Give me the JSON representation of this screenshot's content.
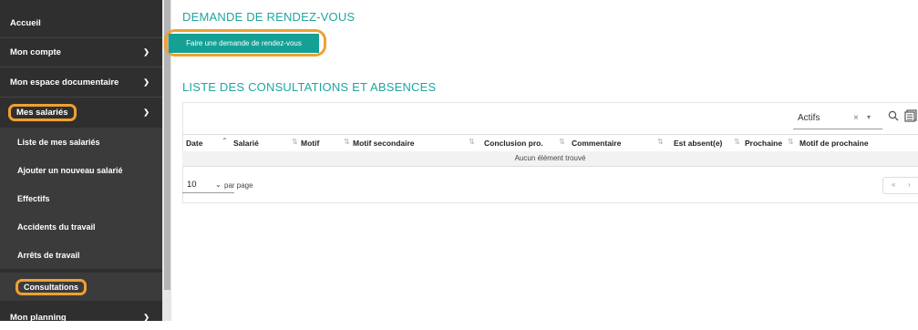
{
  "sidebar": {
    "items": [
      {
        "label": "Accueil"
      },
      {
        "label": "Mon compte"
      },
      {
        "label": "Mon espace documentaire"
      },
      {
        "label": "Mes salariés"
      },
      {
        "label": "Liste de mes salariés"
      },
      {
        "label": "Ajouter un nouveau salarié"
      },
      {
        "label": "Effectifs"
      },
      {
        "label": "Accidents du travail"
      },
      {
        "label": "Arrêts de travail"
      },
      {
        "label": "Consultations"
      },
      {
        "label": "Mon planning"
      }
    ]
  },
  "main": {
    "section1_title": "DEMANDE DE RENDEZ-VOUS",
    "request_button": "Faire une demande de rendez-vous",
    "section2_title": "LISTE DES CONSULTATIONS ET ABSENCES",
    "filter_value": "Actifs",
    "columns": [
      "Date",
      "Salarié",
      "Motif",
      "Motif secondaire",
      "Conclusion pro.",
      "Commentaire",
      "Est absent(e)",
      "Prochaine",
      "Motif de prochaine"
    ],
    "empty_text": "Aucun élément trouvé",
    "per_page_value": "10",
    "per_page_label": "par page",
    "pager": {
      "first": "«",
      "prev": "›"
    }
  },
  "colors": {
    "accent": "#15a096",
    "highlight": "#f0a030",
    "sidebar": "#2f2f2f"
  }
}
